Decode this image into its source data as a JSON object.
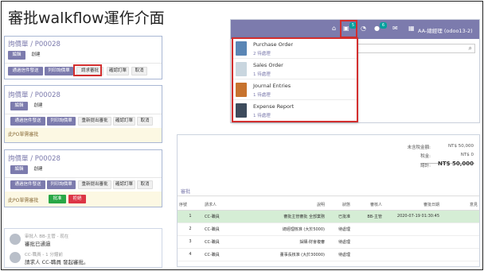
{
  "slide": {
    "title": "審批walkflow運作介面"
  },
  "panel1": {
    "breadcrumb": "詢價單 / P00028",
    "btn_edit": "編輯",
    "btn_create": "創建",
    "actions": [
      "通過信件發送",
      "列印詢價單",
      "請求審批",
      "確認訂單",
      "取消"
    ]
  },
  "panel2": {
    "breadcrumb": "詢價單 / P00028",
    "btn_edit": "編輯",
    "btn_create": "創建",
    "actions": [
      "通過信件發送",
      "列印詢價單",
      "重新提出審批",
      "確認訂單",
      "取消"
    ],
    "notice": "此PO單需審批"
  },
  "panel3": {
    "breadcrumb": "詢價單 / P00028",
    "btn_edit": "編輯",
    "btn_create": "創建",
    "actions": [
      "通過信件發送",
      "列印詢價單",
      "重新提出審批",
      "確認訂單",
      "取消"
    ],
    "notice": "此PO單需審批",
    "btn_approve": "批准",
    "btn_reject": "拒絕"
  },
  "chatter": {
    "messages": [
      {
        "meta": "审批人 BB-主管 - 现在",
        "text": "審批已通過"
      },
      {
        "meta": "CC-職員 - 1 分鐘前",
        "text": "請求人 CC-職員 發起審批。"
      }
    ]
  },
  "navbar": {
    "activity_count": "5",
    "message_count": "6",
    "user": "AA-總經理 (odoo13-2)"
  },
  "activities": [
    {
      "name": "Purchase Order",
      "count": "2 待處理",
      "icon_color": "#5a86b5"
    },
    {
      "name": "Sales Order",
      "count": "1 待處理",
      "icon_color": "#c9d6df"
    },
    {
      "name": "Journal Entries",
      "count": "1 待處理",
      "icon_color": "#c7732e"
    },
    {
      "name": "Expense Report",
      "count": "1 待處理",
      "icon_color": "#3d4b5c"
    }
  ],
  "totals": {
    "untaxed_label": "未含稅金額:",
    "untaxed_value": "NT$ 50,000",
    "tax_label": "稅金:",
    "tax_value": "NT$ 0",
    "total_label": "總計:",
    "total_value": "NT$ 50,000"
  },
  "approvals": {
    "tab_label": "審批",
    "columns": [
      "序號",
      "請求人",
      "說明",
      "狀態",
      "審核人",
      "審批日期",
      "意見"
    ],
    "rows": [
      [
        "1",
        "CC-職員",
        "審批主管審批 全部業務",
        "已批准",
        "BB-主管",
        "2020-07-19 01:30:45",
        ""
      ],
      [
        "2",
        "CC-職員",
        "總經理核准 (大於5000)",
        "待處理",
        "",
        "",
        ""
      ],
      [
        "3",
        "CC-職員",
        "採購-財會複審",
        "待處理",
        "",
        "",
        ""
      ],
      [
        "4",
        "CC-職員",
        "董事長核准 (大於30000)",
        "待處理",
        "",
        "",
        ""
      ]
    ]
  },
  "colors": {
    "brand": "#7c7bad",
    "highlight": "#d32f2f",
    "approve": "#28a745",
    "reject": "#dc3545",
    "approved_row": "#d5edd5"
  }
}
